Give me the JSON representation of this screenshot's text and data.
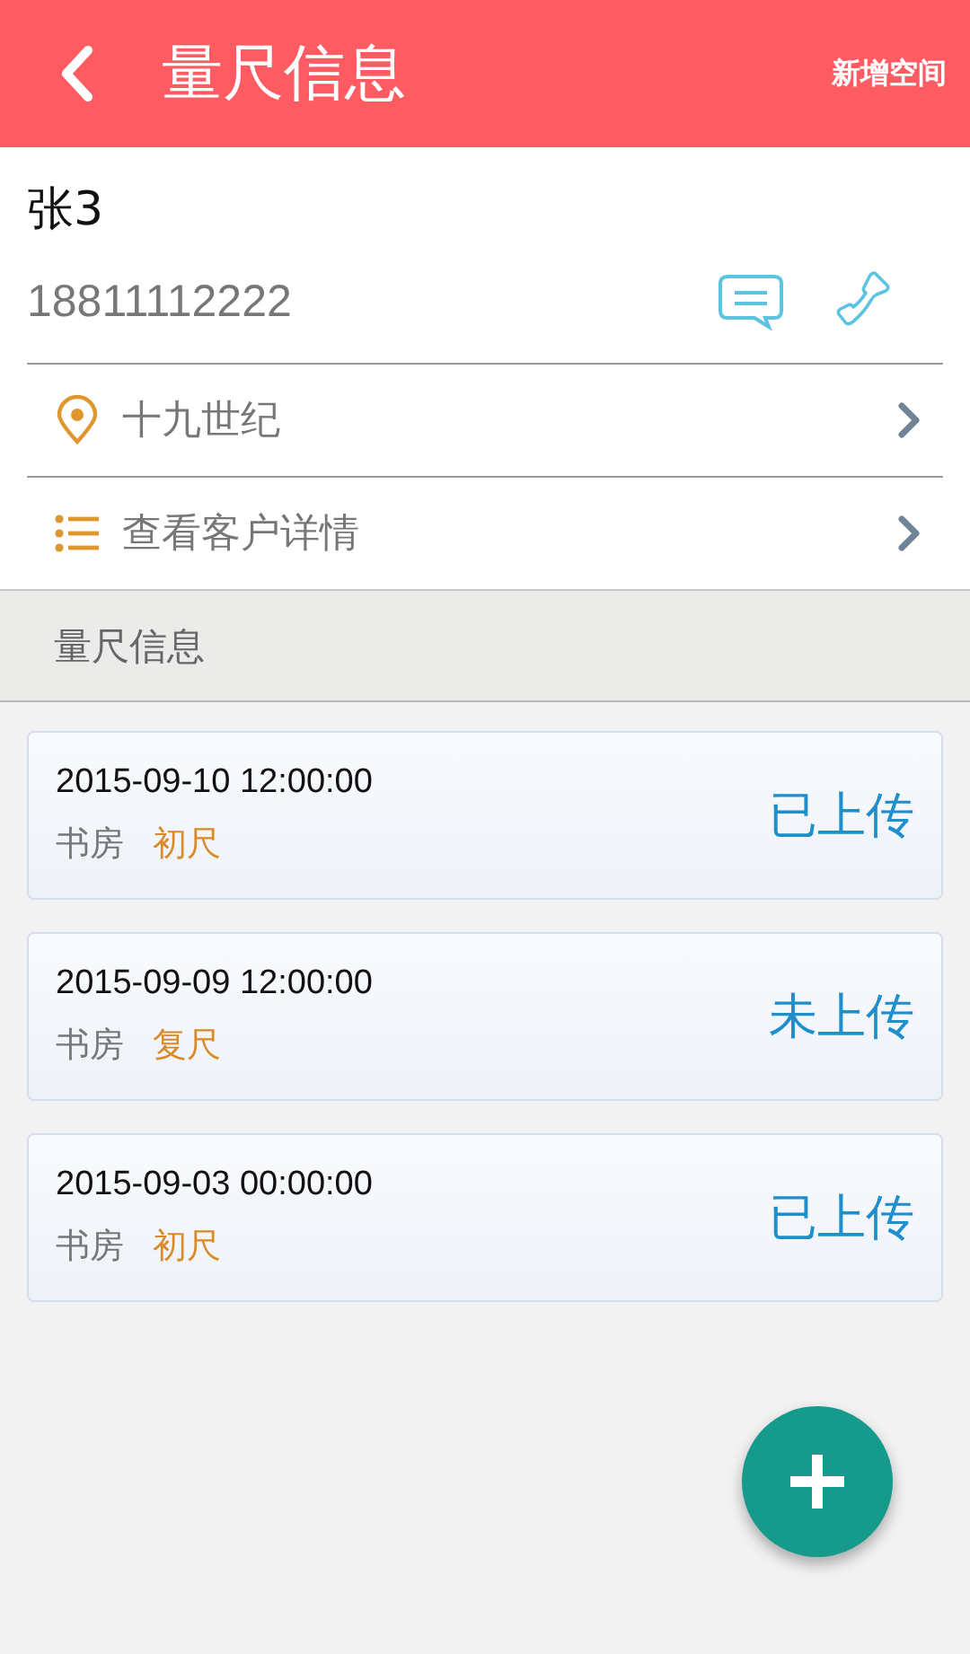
{
  "header": {
    "title": "量尺信息",
    "action": "新增空间"
  },
  "customer": {
    "name": "张3",
    "phone": "18811112222"
  },
  "links": [
    {
      "kind": "location",
      "label": "十九世纪"
    },
    {
      "kind": "details",
      "label": "查看客户详情"
    }
  ],
  "section_title": "量尺信息",
  "records": [
    {
      "datetime": "2015-09-10 12:00:00",
      "room": "书房",
      "type": "初尺",
      "status": "已上传"
    },
    {
      "datetime": "2015-09-09 12:00:00",
      "room": "书房",
      "type": "复尺",
      "status": "未上传"
    },
    {
      "datetime": "2015-09-03 00:00:00",
      "room": "书房",
      "type": "初尺",
      "status": "已上传"
    }
  ]
}
